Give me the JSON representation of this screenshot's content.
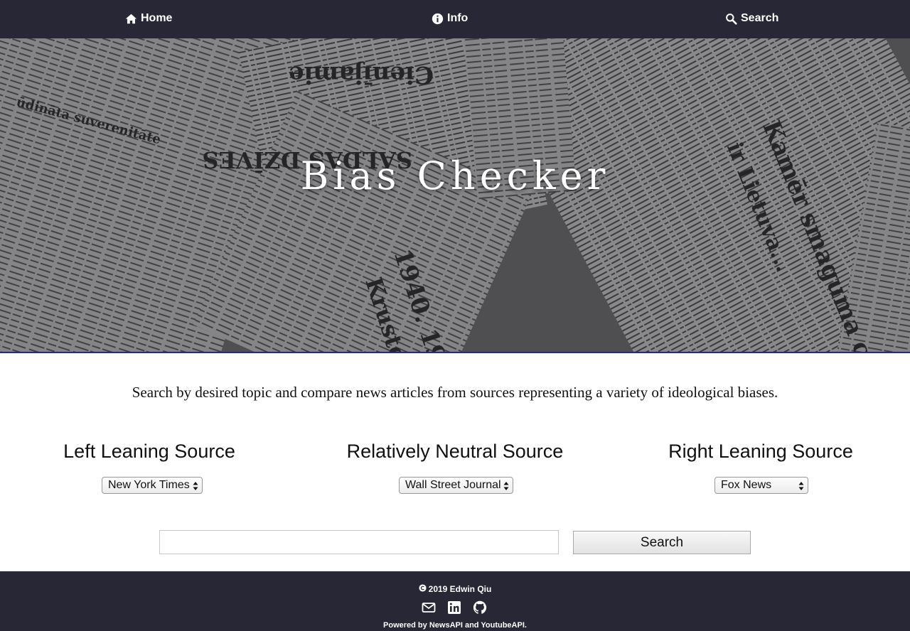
{
  "nav": {
    "home_label": "Home",
    "home_icon": "home-icon",
    "info_label": "Info",
    "info_icon": "info-circle-icon",
    "search_label": "Search",
    "search_icon": "search-icon",
    "background": "#272735"
  },
  "hero": {
    "title": "Bias Checker",
    "background": "newspaper-collage",
    "border_color": "#1a22c8"
  },
  "tagline": "Search by desired topic and compare news articles from sources representing a variety of ideological biases.",
  "sources": {
    "left": {
      "heading": "Left Leaning Source",
      "selected": "New York Times"
    },
    "neutral": {
      "heading": "Relatively Neutral Source",
      "selected": "Wall Street Journal"
    },
    "right": {
      "heading": "Right Leaning Source",
      "selected": "Fox News"
    }
  },
  "search": {
    "value": "",
    "placeholder": "",
    "button_label": "Search"
  },
  "footer": {
    "copyright": "2019 Edwin Qiu",
    "copyright_icon": "copyright-icon",
    "icons": [
      "envelope-icon",
      "linkedin-icon",
      "github-icon"
    ],
    "powered_by": "Powered by NewsAPI and YoutubeAPI."
  }
}
